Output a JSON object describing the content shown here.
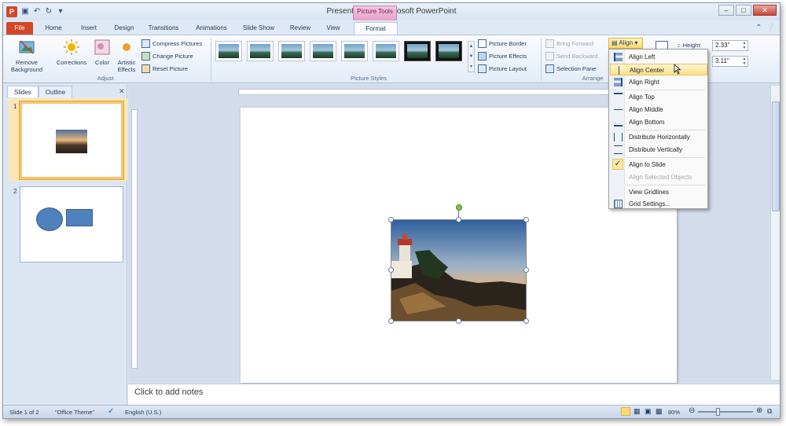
{
  "window": {
    "title": "Presentation1 - Microsoft PowerPoint",
    "contextual_tab": "Picture Tools"
  },
  "tabs": [
    "File",
    "Home",
    "Insert",
    "Design",
    "Transitions",
    "Animations",
    "Slide Show",
    "Review",
    "View",
    "Format"
  ],
  "ribbon": {
    "adjust": {
      "remove_background": "Remove Background",
      "corrections": "Corrections",
      "color": "Color",
      "artistic_effects": "Artistic Effects",
      "compress": "Compress Pictures",
      "change": "Change Picture",
      "reset": "Reset Picture",
      "label": "Adjust"
    },
    "picture_styles": {
      "label": "Picture Styles",
      "border": "Picture Border",
      "effects": "Picture Effects",
      "layout": "Picture Layout"
    },
    "arrange": {
      "bring_forward": "Bring Forward",
      "send_backward": "Send Backward",
      "selection_pane": "Selection Pane",
      "align": "Align",
      "label": "Arrange"
    },
    "size": {
      "height_label": "Height:",
      "height": "2.33\"",
      "width": "3.11\""
    }
  },
  "align_menu": {
    "items": [
      {
        "label": "Align Left",
        "state": "normal"
      },
      {
        "label": "Align Center",
        "state": "hover"
      },
      {
        "label": "Align Right",
        "state": "normal"
      },
      {
        "label": "Align Top",
        "state": "normal"
      },
      {
        "label": "Align Middle",
        "state": "normal"
      },
      {
        "label": "Align Bottom",
        "state": "normal"
      },
      {
        "label": "Distribute Horizontally",
        "state": "normal"
      },
      {
        "label": "Distribute Vertically",
        "state": "normal"
      },
      {
        "label": "Align to Slide",
        "state": "checked"
      },
      {
        "label": "Align Selected Objects",
        "state": "disabled"
      },
      {
        "label": "View Gridlines",
        "state": "normal"
      },
      {
        "label": "Grid Settings...",
        "state": "normal"
      }
    ]
  },
  "slides_panel": {
    "tabs": [
      "Slides",
      "Outline"
    ],
    "slide_numbers": [
      "1",
      "2"
    ]
  },
  "notes": {
    "placeholder": "Click to add notes"
  },
  "status": {
    "slide": "Slide 1 of 2",
    "theme": "\"Office Theme\"",
    "language": "English (U.S.)",
    "zoom": "80%"
  }
}
